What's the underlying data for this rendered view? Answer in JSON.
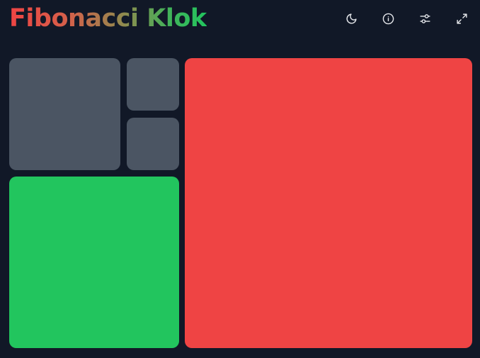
{
  "app": {
    "title": "Fibonacci Klok"
  },
  "toolbar": {
    "buttons": [
      {
        "name": "theme-toggle-button",
        "icon": "moon-icon"
      },
      {
        "name": "info-button",
        "icon": "info-icon"
      },
      {
        "name": "settings-button",
        "icon": "sliders-icon"
      },
      {
        "name": "fullscreen-button",
        "icon": "expand-icon"
      }
    ]
  },
  "clock": {
    "colors": {
      "off": "#4b5563",
      "minutes": "#22c55e",
      "hours": "#ef4444",
      "background": "#111827"
    },
    "squares": [
      {
        "fib": 1,
        "state": "off"
      },
      {
        "fib": 1,
        "state": "off"
      },
      {
        "fib": 2,
        "state": "off"
      },
      {
        "fib": 3,
        "state": "minutes"
      },
      {
        "fib": 5,
        "state": "hours"
      }
    ]
  }
}
